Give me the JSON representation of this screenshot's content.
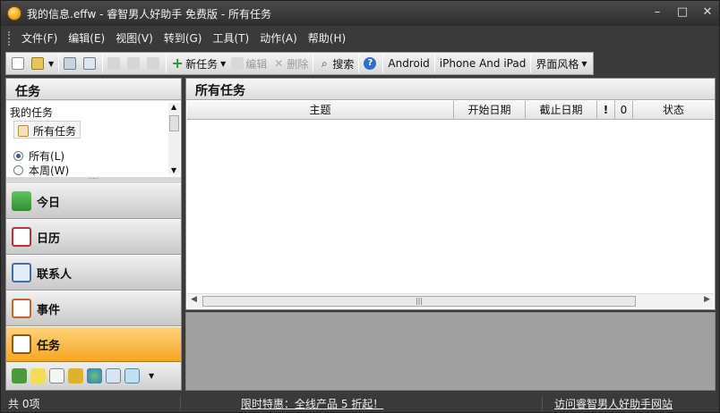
{
  "window": {
    "title": "我的信息.effw - 睿智男人好助手 免费版 - 所有任务",
    "minimize": "–",
    "maximize": "□",
    "close": "✕"
  },
  "menu": [
    "文件(F)",
    "编辑(E)",
    "视图(V)",
    "转到(G)",
    "工具(T)",
    "动作(A)",
    "帮助(H)"
  ],
  "toolbar": {
    "new_task": "新任务",
    "edit": "编辑",
    "delete": "删除",
    "search": "搜索",
    "android": "Android",
    "iphone": "iPhone And iPad",
    "theme": "界面风格"
  },
  "left_pane": {
    "header": "任务",
    "my_tasks": "我的任务",
    "all_tasks": "所有任务",
    "filter_all": "所有(L)",
    "filter_week": "本周(W)",
    "nav": [
      "今日",
      "日历",
      "联系人",
      "事件",
      "任务"
    ]
  },
  "right_pane": {
    "header": "所有任务",
    "columns": [
      "主题",
      "开始日期",
      "截止日期",
      "!",
      "0",
      "状态"
    ]
  },
  "status": {
    "count": "共 0项",
    "promo": "限时特惠：全线产品 5 折起！",
    "site": "访问睿智男人好助手网站"
  },
  "colors": {
    "accent": "#f6a623",
    "chrome": "#3a3a3a"
  }
}
